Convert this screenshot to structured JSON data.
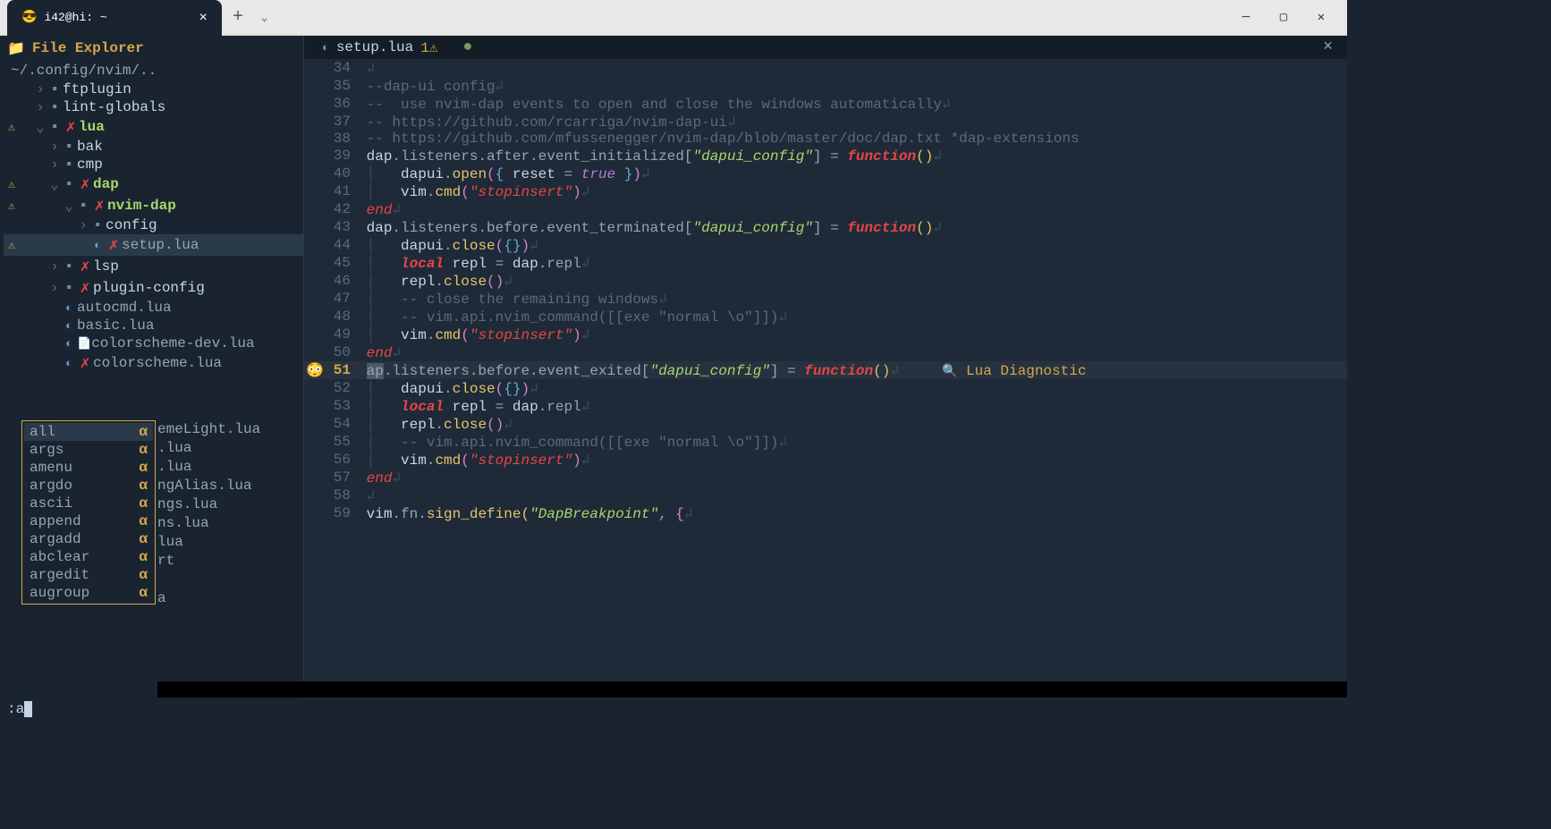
{
  "window": {
    "tab_title": "i42@hi: ~",
    "tab_emoji": "😎"
  },
  "sidebar": {
    "title": "File Explorer",
    "folder_emoji": "📁",
    "path": "~/.config/nvim/..",
    "tree": [
      {
        "indent": 1,
        "arrow": "›",
        "icon": "folder",
        "name": "ftplugin",
        "type": "folder"
      },
      {
        "indent": 1,
        "arrow": "›",
        "icon": "folder",
        "name": "lint-globals",
        "type": "folder"
      },
      {
        "warn": true,
        "indent": 1,
        "arrow": "⌄",
        "icon": "folder",
        "x": true,
        "name": "lua",
        "type": "active"
      },
      {
        "indent": 2,
        "arrow": "›",
        "icon": "folder",
        "name": "bak",
        "type": "folder"
      },
      {
        "indent": 2,
        "arrow": "›",
        "icon": "folder",
        "name": "cmp",
        "type": "folder"
      },
      {
        "warn": true,
        "indent": 2,
        "arrow": "⌄",
        "icon": "folder",
        "x": true,
        "name": "dap",
        "type": "active"
      },
      {
        "warn": true,
        "indent": 3,
        "arrow": "⌄",
        "icon": "folder",
        "x": true,
        "name": "nvim-dap",
        "type": "active"
      },
      {
        "indent": 4,
        "arrow": "›",
        "icon": "folder",
        "name": "config",
        "type": "folder"
      },
      {
        "warn": true,
        "indent": 4,
        "selected": true,
        "lua": true,
        "x": true,
        "name": "setup.lua",
        "type": "lua"
      },
      {
        "indent": 2,
        "arrow": "›",
        "icon": "folder",
        "x": true,
        "name": "lsp",
        "type": "folder"
      },
      {
        "indent": 2,
        "arrow": "›",
        "icon": "folder",
        "x": true,
        "name": "plugin-config",
        "type": "folder"
      },
      {
        "indent": 2,
        "lua": true,
        "name": "autocmd.lua",
        "type": "lua"
      },
      {
        "indent": 2,
        "lua": true,
        "name": "basic.lua",
        "type": "lua"
      },
      {
        "indent": 2,
        "lua": true,
        "doc": true,
        "name": "colorscheme-dev.lua",
        "type": "lua"
      },
      {
        "indent": 2,
        "lua": true,
        "x": true,
        "name": "colorscheme.lua",
        "type": "lua"
      }
    ],
    "partial_items": [
      "emeLight.lua",
      ".lua",
      ".lua",
      "ngAlias.lua",
      "ngs.lua",
      "ns.lua",
      "lua",
      "rt",
      "",
      "a"
    ]
  },
  "completion": {
    "items": [
      "all",
      "args",
      "amenu",
      "argdo",
      "ascii",
      "append",
      "argadd",
      "abclear",
      "argedit",
      "augroup"
    ]
  },
  "editor": {
    "tab_name": "setup.lua",
    "tab_warn": "1⚠",
    "lines": {
      "34": "",
      "35_comment": "--dap-ui config",
      "36_comment": "--  use nvim-dap events to open and close the windows automatically",
      "37_comment": "-- https://github.com/rcarriga/nvim-dap-ui",
      "38_comment": "-- https://github.com/mfussenegger/nvim-dap/blob/master/doc/dap.txt *dap-extensions",
      "39": {
        "pre": "dap.listeners.after.event_initialized[",
        "s": "\"dapui_config\"",
        "post": "] = ",
        "kw": "function",
        "paren": "()"
      },
      "40": {
        "call": "dapui",
        "m": ".open(",
        "brace": "{ ",
        "var": "reset = ",
        "bool": "true",
        "brace2": " }",
        "close": ")"
      },
      "41": {
        "call": "vim",
        "m": ".cmd(",
        "s": "\"stopinsert\"",
        "close": ")"
      },
      "42_end": "end",
      "43": {
        "pre": "dap.listeners.before.event_terminated[",
        "s": "\"dapui_config\"",
        "post": "] = ",
        "kw": "function",
        "paren": "()"
      },
      "44": {
        "call": "dapui",
        "m": ".close(",
        "brace": "{}",
        "close": ")"
      },
      "45": {
        "kw": "local",
        "var": " repl = dap.repl"
      },
      "46": {
        "call": "repl",
        "m": ".close()"
      },
      "47_comment": "-- close the remaining windows",
      "48_comment": "-- vim.api.nvim_command([[exe \"normal \\<c-w>o\"]])",
      "49": {
        "call": "vim",
        "m": ".cmd(",
        "s": "\"stopinsert\"",
        "close": ")"
      },
      "50_end": "end",
      "51": {
        "sel": "ap",
        "pre": ".listeners.before.event_exited[",
        "s": "\"dapui_config\"",
        "post": "] = ",
        "kw": "function",
        "paren": "()",
        "diag": "Lua Diagnostic"
      },
      "52": {
        "call": "dapui",
        "m": ".close(",
        "brace": "{}",
        "close": ")"
      },
      "53": {
        "kw": "local",
        "var": " repl = dap.repl"
      },
      "54": {
        "call": "repl",
        "m": ".close()"
      },
      "55_comment": "-- vim.api.nvim_command([[exe \"normal \\<c-w>o\"]])",
      "56": {
        "call": "vim",
        "m": ".cmd(",
        "s": "\"stopinsert\"",
        "close": ")"
      },
      "57_end": "end",
      "58": "",
      "59": {
        "call": "vim.fn",
        "m": ".sign_define(",
        "s": "\"DapBreakpoint\"",
        "post": ", ",
        "brace": "{"
      }
    }
  },
  "cmdline": ":a"
}
